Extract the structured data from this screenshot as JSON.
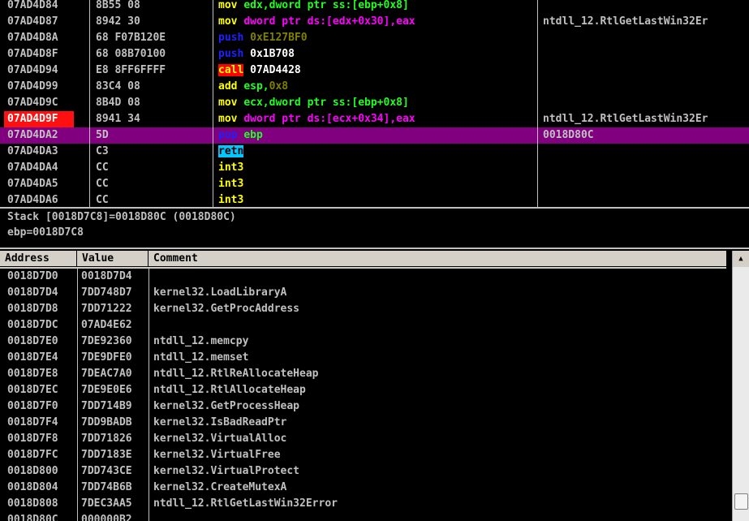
{
  "disasm": [
    {
      "addr": "07AD4D84",
      "hex": "8B55 08",
      "asm": [
        [
          "mov ",
          "k-mov"
        ],
        [
          "edx,dword ptr ss:[ebp+0x8]",
          "o-reg"
        ]
      ],
      "comment": ""
    },
    {
      "addr": "07AD4D87",
      "hex": "8942 30",
      "asm": [
        [
          "mov ",
          "k-mov"
        ],
        [
          "dword ptr ds:[edx+0x30],eax",
          "o-mem"
        ]
      ],
      "comment": "ntdll_12.RtlGetLastWin32Er"
    },
    {
      "addr": "07AD4D8A",
      "hex": "68 F07B120E",
      "asm": [
        [
          "push ",
          "k-push"
        ],
        [
          "0xE127BF0",
          "o-cst"
        ]
      ],
      "comment": ""
    },
    {
      "addr": "07AD4D8F",
      "hex": "68 08B70100",
      "asm": [
        [
          "push ",
          "k-push"
        ],
        [
          "0x1B708",
          "o-txt"
        ]
      ],
      "comment": ""
    },
    {
      "addr": "07AD4D94",
      "hex": "E8 8FF6FFFF",
      "asm": [
        [
          "call",
          "k-call"
        ],
        [
          " 07AD4428",
          "o-txt"
        ]
      ],
      "comment": ""
    },
    {
      "addr": "07AD4D99",
      "hex": "83C4 08",
      "asm": [
        [
          "add ",
          "k-add"
        ],
        [
          "esp,",
          "o-reg"
        ],
        [
          "0x8",
          "o-cst"
        ]
      ],
      "comment": ""
    },
    {
      "addr": "07AD4D9C",
      "hex": "8B4D 08",
      "asm": [
        [
          "mov ",
          "k-mov"
        ],
        [
          "ecx,dword ptr ss:[ebp+0x8]",
          "o-reg"
        ]
      ],
      "comment": ""
    },
    {
      "addr": "07AD4D9F",
      "hex": "8941 34",
      "asm": [
        [
          "mov ",
          "k-mov"
        ],
        [
          "dword ptr ds:[ecx+0x34],eax",
          "o-mem"
        ]
      ],
      "comment": "ntdll_12.RtlGetLastWin32Er",
      "bp": true
    },
    {
      "addr": "07AD4DA2",
      "hex": "5D",
      "asm": [
        [
          "pop ",
          "k-push"
        ],
        [
          "ebp",
          "o-reg"
        ]
      ],
      "comment": "0018D80C",
      "sel": true
    },
    {
      "addr": "07AD4DA3",
      "hex": "C3",
      "asm": [
        [
          "retn",
          "k-retn"
        ]
      ],
      "comment": ""
    },
    {
      "addr": "07AD4DA4",
      "hex": "CC",
      "asm": [
        [
          "int3",
          "k-int3"
        ]
      ],
      "comment": ""
    },
    {
      "addr": "07AD4DA5",
      "hex": "CC",
      "asm": [
        [
          "int3",
          "k-int3"
        ]
      ],
      "comment": ""
    },
    {
      "addr": "07AD4DA6",
      "hex": "CC",
      "asm": [
        [
          "int3",
          "k-int3"
        ]
      ],
      "comment": ""
    }
  ],
  "info": {
    "line1": "Stack [0018D7C8]=0018D80C (0018D80C)",
    "line2": "ebp=0018D7C8"
  },
  "stack": {
    "headers": {
      "address": "Address",
      "value": "Value",
      "comment": "Comment"
    },
    "rows": [
      {
        "addr": "0018D7D0",
        "val": "0018D7D4",
        "comment": ""
      },
      {
        "addr": "0018D7D4",
        "val": "7DD748D7",
        "comment": "kernel32.LoadLibraryA"
      },
      {
        "addr": "0018D7D8",
        "val": "7DD71222",
        "comment": "kernel32.GetProcAddress"
      },
      {
        "addr": "0018D7DC",
        "val": "07AD4E62",
        "comment": ""
      },
      {
        "addr": "0018D7E0",
        "val": "7DE92360",
        "comment": "ntdll_12.memcpy"
      },
      {
        "addr": "0018D7E4",
        "val": "7DE9DFE0",
        "comment": "ntdll_12.memset"
      },
      {
        "addr": "0018D7E8",
        "val": "7DEAC7A0",
        "comment": "ntdll_12.RtlReAllocateHeap"
      },
      {
        "addr": "0018D7EC",
        "val": "7DE9E0E6",
        "comment": "ntdll_12.RtlAllocateHeap"
      },
      {
        "addr": "0018D7F0",
        "val": "7DD714B9",
        "comment": "kernel32.GetProcessHeap"
      },
      {
        "addr": "0018D7F4",
        "val": "7DD9BADB",
        "comment": "kernel32.IsBadReadPtr"
      },
      {
        "addr": "0018D7F8",
        "val": "7DD71826",
        "comment": "kernel32.VirtualAlloc"
      },
      {
        "addr": "0018D7FC",
        "val": "7DD7183E",
        "comment": "kernel32.VirtualFree"
      },
      {
        "addr": "0018D800",
        "val": "7DD743CE",
        "comment": "kernel32.VirtualProtect"
      },
      {
        "addr": "0018D804",
        "val": "7DD74B6B",
        "comment": "kernel32.CreateMutexA"
      },
      {
        "addr": "0018D808",
        "val": "7DEC3AA5",
        "comment": "ntdll_12.RtlGetLastWin32Error"
      },
      {
        "addr": "0018D80C",
        "val": "000000B2",
        "comment": ""
      }
    ]
  },
  "scrollbar": {
    "up_icon": "up-arrow-icon"
  }
}
